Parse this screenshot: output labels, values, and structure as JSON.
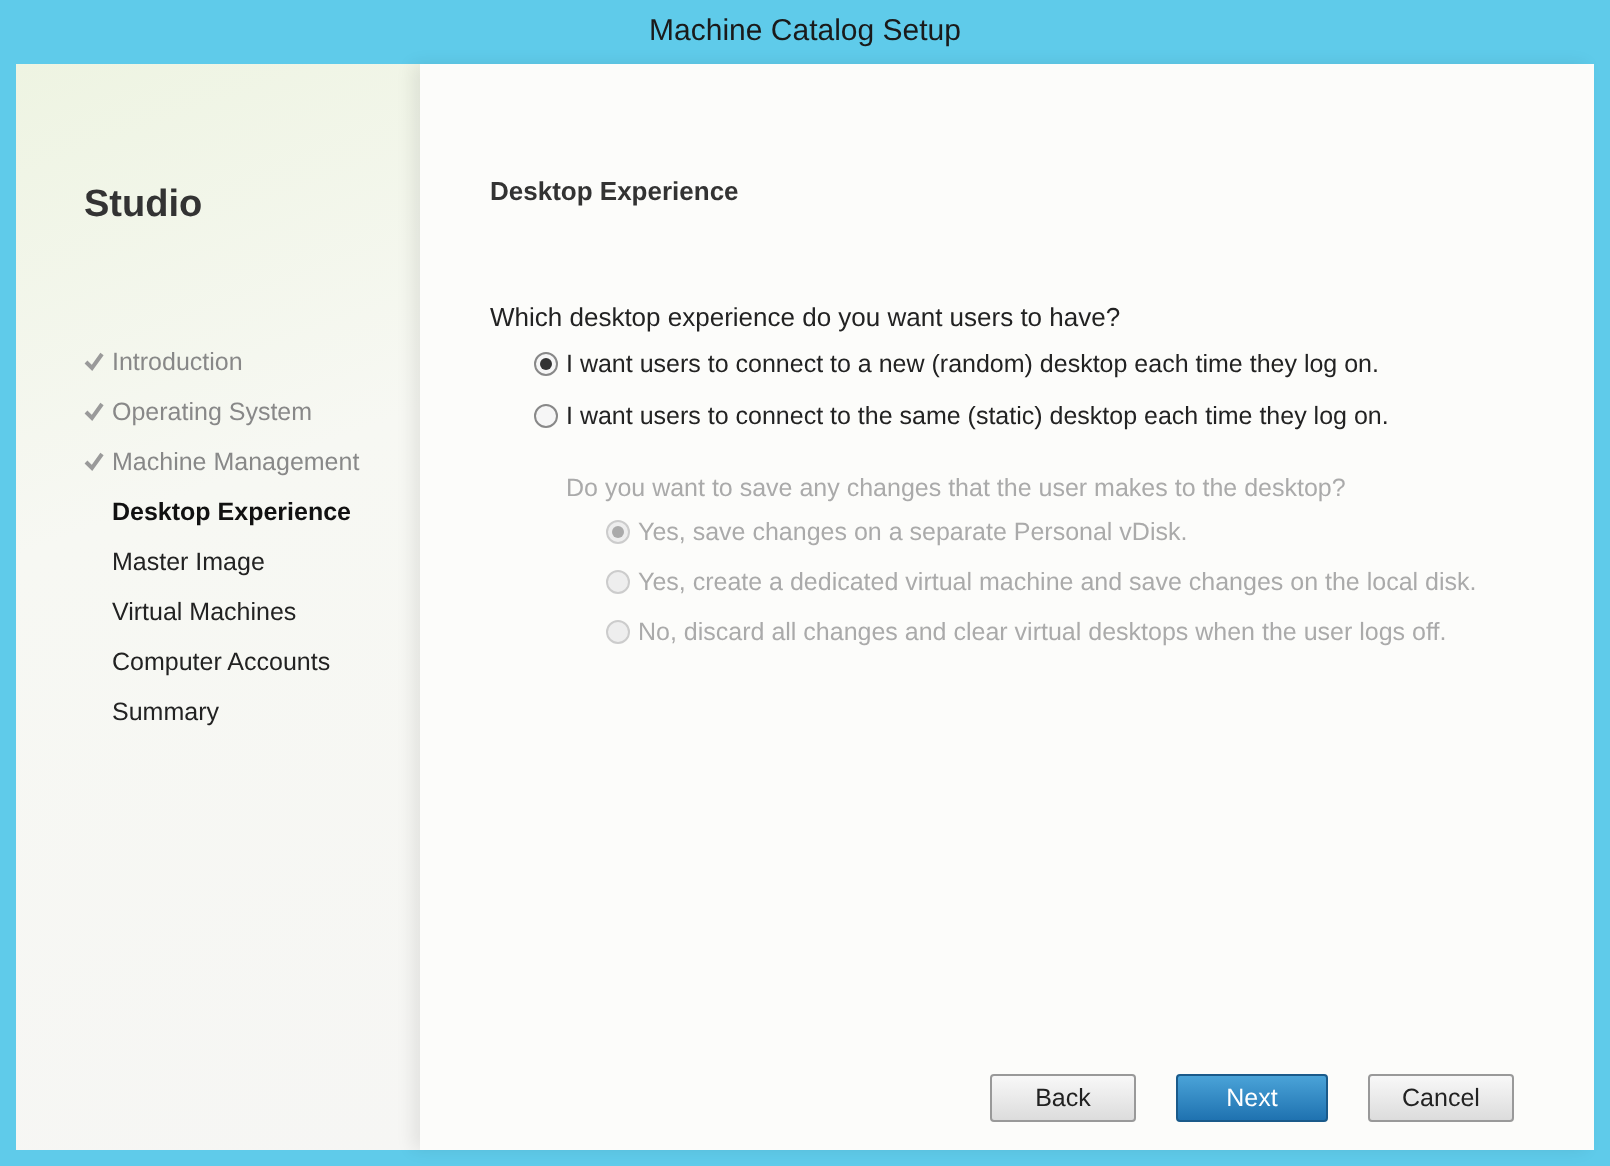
{
  "window": {
    "title": "Machine Catalog Setup"
  },
  "sidebar": {
    "brand": "Studio",
    "steps": [
      {
        "label": "Introduction",
        "completed": true,
        "selected": false
      },
      {
        "label": "Operating System",
        "completed": true,
        "selected": false
      },
      {
        "label": "Machine Management",
        "completed": true,
        "selected": false
      },
      {
        "label": "Desktop Experience",
        "completed": false,
        "selected": true
      },
      {
        "label": "Master Image",
        "completed": false,
        "selected": false
      },
      {
        "label": "Virtual Machines",
        "completed": false,
        "selected": false
      },
      {
        "label": "Computer Accounts",
        "completed": false,
        "selected": false
      },
      {
        "label": "Summary",
        "completed": false,
        "selected": false
      }
    ]
  },
  "page": {
    "heading": "Desktop Experience",
    "question": "Which desktop experience do you want users to have?",
    "options": [
      {
        "label": "I want users to connect to a new (random) desktop each time they log on.",
        "selected": true,
        "disabled": false
      },
      {
        "label": "I want users to connect to the same (static) desktop each time they log on.",
        "selected": false,
        "disabled": false
      }
    ],
    "sub_question": {
      "text": "Do you want to save any changes that the user makes to the desktop?",
      "disabled": true
    },
    "sub_options": [
      {
        "label": "Yes, save changes on a separate Personal vDisk.",
        "selected": true,
        "disabled": true
      },
      {
        "label": "Yes, create a dedicated virtual machine and save changes on the local disk.",
        "selected": false,
        "disabled": true
      },
      {
        "label": "No, discard all changes and clear virtual desktops when the user logs off.",
        "selected": false,
        "disabled": true
      }
    ]
  },
  "buttons": [
    {
      "label": "Back",
      "kind": "default"
    },
    {
      "label": "Next",
      "kind": "primary"
    },
    {
      "label": "Cancel",
      "kind": "default"
    }
  ]
}
